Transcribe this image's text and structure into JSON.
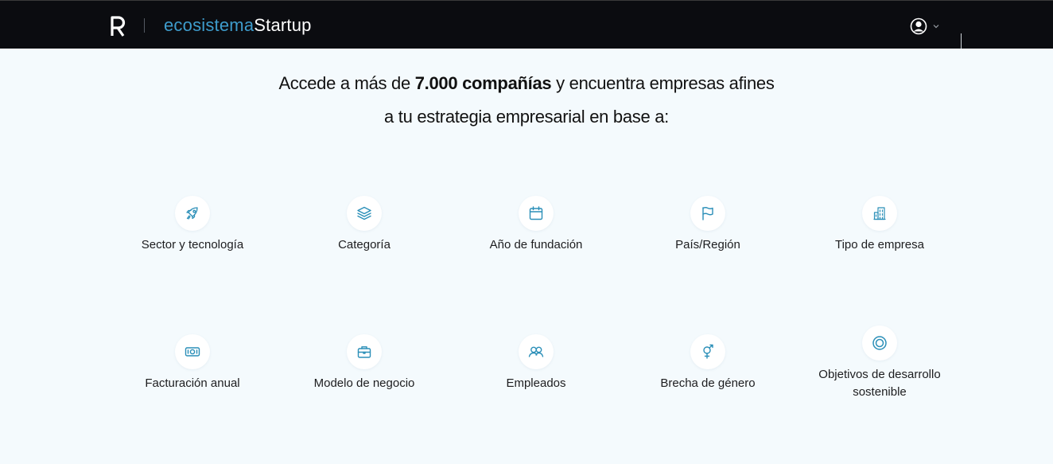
{
  "header": {
    "brand_part1": "ecosistema",
    "brand_part2": "Startup",
    "accent_color": "#3e9ccc",
    "bar_color": "#0b0c10"
  },
  "headline": {
    "line1_pre": "Accede a más de ",
    "line1_strong": "7.000 compañías",
    "line1_post": " y encuentra empresas afines",
    "line2": "a tu estrategia empresarial en base a:"
  },
  "filters_row1": [
    {
      "label": "Sector y tecnología",
      "icon": "rocket-icon"
    },
    {
      "label": "Categoría",
      "icon": "layers-icon"
    },
    {
      "label": "Año de fundación",
      "icon": "calendar-icon"
    },
    {
      "label": "País/Región",
      "icon": "flag-icon"
    },
    {
      "label": "Tipo de empresa",
      "icon": "building-icon"
    }
  ],
  "filters_row2": [
    {
      "label": "Facturación anual",
      "icon": "banknote-icon"
    },
    {
      "label": "Modelo de negocio",
      "icon": "briefcase-icon"
    },
    {
      "label": "Empleados",
      "icon": "users-icon"
    },
    {
      "label": "Brecha de género",
      "icon": "gender-icon"
    },
    {
      "label": "Objetivos de desarrollo sostenible",
      "icon": "target-icon"
    }
  ]
}
